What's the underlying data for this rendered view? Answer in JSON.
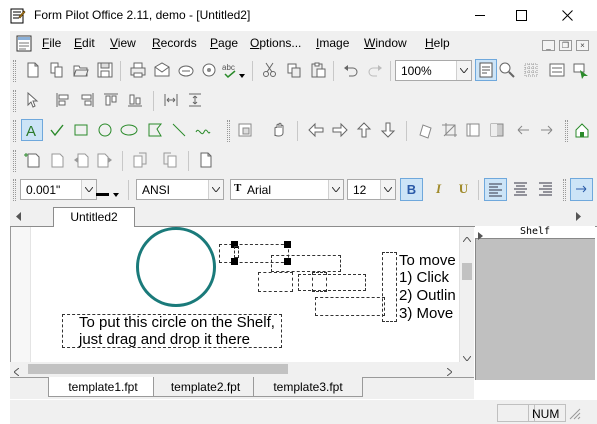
{
  "window": {
    "title": "Form Pilot Office 2.11, demo - [Untitled2]",
    "minimize_glyph": "—",
    "maximize_glyph": "☐",
    "close_glyph": "✕"
  },
  "menu": {
    "items": [
      "File",
      "Edit",
      "View",
      "Records",
      "Page",
      "Options...",
      "Image",
      "Window",
      "Help"
    ]
  },
  "toolbar1": {
    "zoom_value": "100%"
  },
  "format_bar": {
    "line_width": "0.001\"",
    "charset": "ANSI",
    "font": "Arial",
    "font_size": "12",
    "bold_label": "B",
    "italic_label": "I",
    "underline_label": "U"
  },
  "doc_tab": {
    "label": "Untitled2"
  },
  "canvas": {
    "instruction_1_line_1": "To put this circle on the Shelf,",
    "instruction_1_line_2": "just drag and drop it there",
    "instruction_2_line_1": "To move",
    "instruction_2_line_2": "1) Click",
    "instruction_2_line_3": "2) Outlin",
    "instruction_2_line_4": "3) Move"
  },
  "shelf": {
    "title": "Shelf"
  },
  "template_tabs": [
    "template1.fpt",
    "template2.fpt",
    "template3.fpt"
  ],
  "status": {
    "num": "NUM"
  },
  "colors": {
    "circle": "#1a7a7a",
    "accent": "#0078d7"
  }
}
